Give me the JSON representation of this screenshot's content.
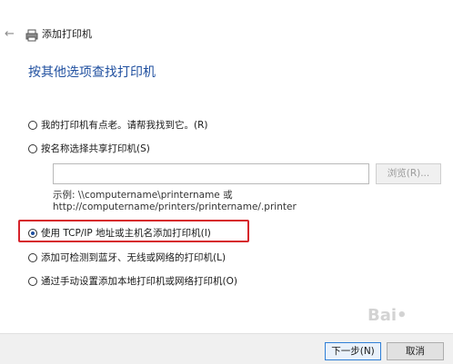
{
  "header": {
    "back_icon": "arrow-left-icon",
    "printer_icon": "printer-icon",
    "title": "添加打印机"
  },
  "heading": "按其他选项查找打印机",
  "options": [
    {
      "label": "我的打印机有点老。请帮我找到它。(R)",
      "selected": false
    },
    {
      "label": "按名称选择共享打印机(S)",
      "selected": false
    },
    {
      "label": "使用 TCP/IP 地址或主机名添加打印机(I)",
      "selected": true
    },
    {
      "label": "添加可检测到蓝牙、无线或网络的打印机(L)",
      "selected": false
    },
    {
      "label": "通过手动设置添加本地打印机或网络打印机(O)",
      "selected": false
    }
  ],
  "share": {
    "input_value": "",
    "browse_label": "浏览(R)...",
    "example_line1": "示例: \\\\computername\\printername 或",
    "example_line2": "http://computername/printers/printername/.printer"
  },
  "footer": {
    "next_label": "下一步(N)",
    "cancel_label": "取消"
  },
  "colors": {
    "heading": "#1f4f9f",
    "highlight_border": "#d6232b",
    "next_border": "#2f7fd6",
    "footer_bg": "#f0f0f0"
  }
}
